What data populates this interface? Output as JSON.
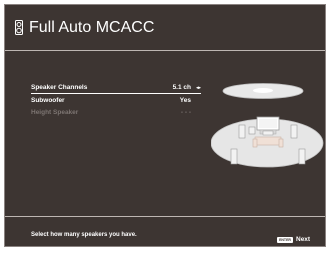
{
  "header": {
    "icon": "speaker-icon",
    "title": "Full Auto MCACC"
  },
  "settings": [
    {
      "label": "Speaker Channels",
      "value": "5.1 ch",
      "selected": true
    },
    {
      "label": "Subwoofer",
      "value": "Yes",
      "selected": false
    },
    {
      "label": "Height Speaker",
      "value": "- - -",
      "disabled": true
    }
  ],
  "footer": {
    "hint": "Select how many speakers you have.",
    "enter_key": "ENTER",
    "next_label": "Next"
  },
  "colors": {
    "background": "#3d3532",
    "text": "#ffffff",
    "disabled_text": "#7d7572",
    "rule": "#bdb6b2"
  }
}
